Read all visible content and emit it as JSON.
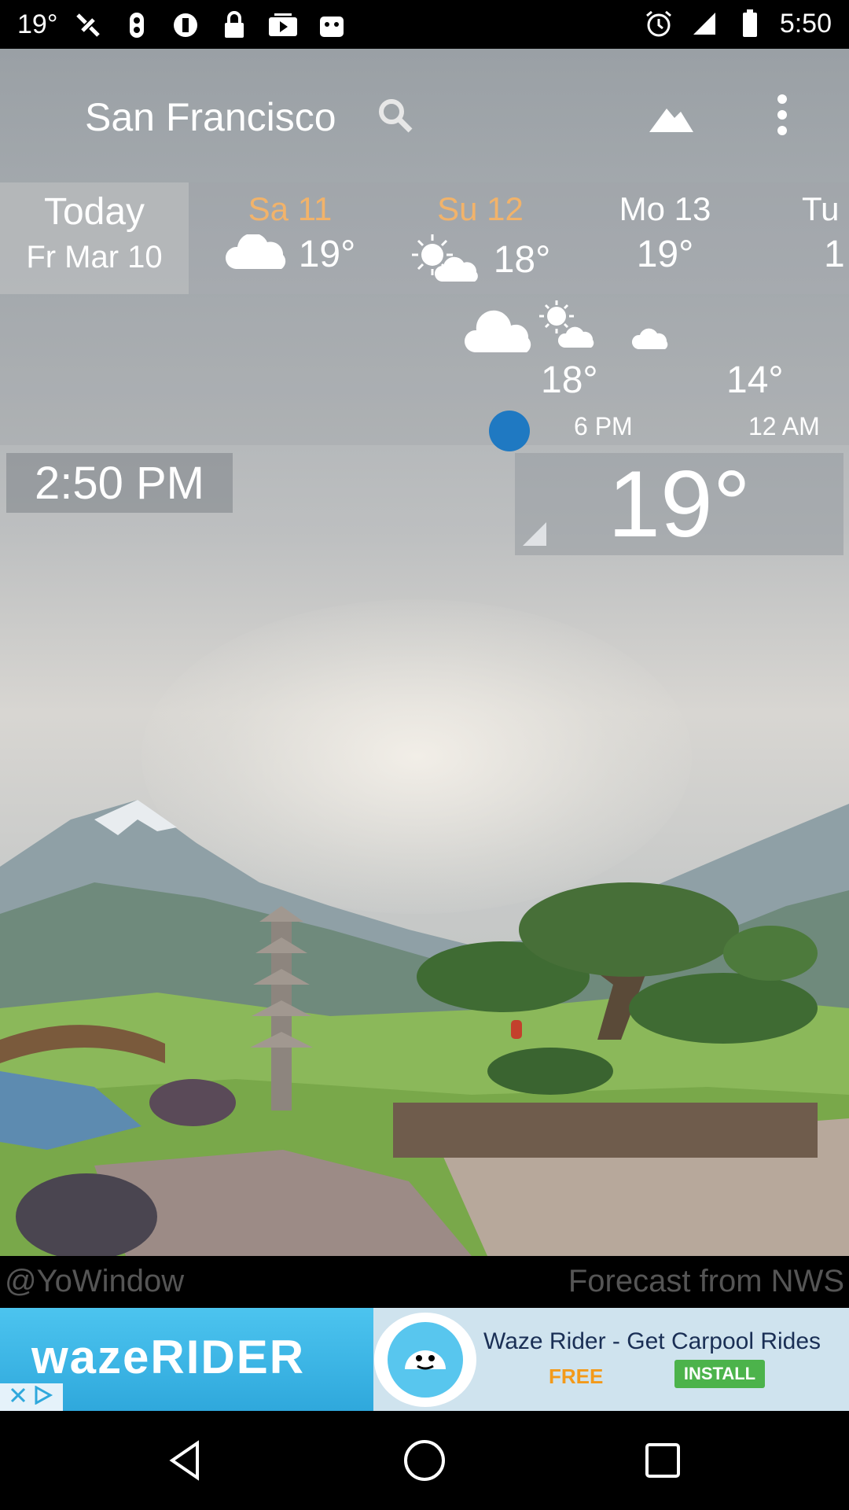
{
  "status_bar": {
    "temperature": "19°",
    "time": "5:50",
    "icons_left": [
      "satellite-icon",
      "sync-icon",
      "info-icon",
      "lock-icon",
      "play-icon",
      "android-icon"
    ],
    "icons_right": [
      "alarm-icon"
    ]
  },
  "header": {
    "city": "San Francisco",
    "icons": [
      "search-icon",
      "landscape-icon",
      "more-vert-icon"
    ]
  },
  "forecast": {
    "today": {
      "label": "Today",
      "date": "Fr Mar 10"
    },
    "days": [
      {
        "name": "Sa 11",
        "temp": "19°",
        "icon": "cloud-icon",
        "weekend": true
      },
      {
        "name": "Su 12",
        "temp": "18°",
        "icon": "sun-cloud-icon",
        "weekend": true
      },
      {
        "name": "Mo 13",
        "temp": "19°",
        "icon": "",
        "weekend": false
      },
      {
        "name": "Tu",
        "temp": "1",
        "icon": "",
        "weekend": false
      }
    ]
  },
  "hourly": {
    "icons": [
      "cloud-icon",
      "sun-cloud-icon",
      "moon-cloud-icon"
    ],
    "points": [
      {
        "temp": "18°",
        "time": "6 PM"
      },
      {
        "temp": "14°",
        "time": "12 AM"
      }
    ]
  },
  "current": {
    "time": "2:50 PM",
    "temp": "19°"
  },
  "footer": {
    "credit": "@YoWindow",
    "source": "Forecast from NWS"
  },
  "ad": {
    "brand_text": "wazeRIDER",
    "headline": "Waze Rider - Get Carpool Rides",
    "price": "FREE",
    "cta": "INSTALL",
    "icons": [
      "waze-logo-icon",
      "close-icon",
      "ad-choices-icon"
    ]
  },
  "nav": {
    "icons": [
      "back-icon",
      "home-icon",
      "recents-icon"
    ]
  },
  "colors": {
    "accent_weekend": "#f2b36a",
    "time_marker": "#1f79c2",
    "ad_install": "#4cb34b"
  }
}
